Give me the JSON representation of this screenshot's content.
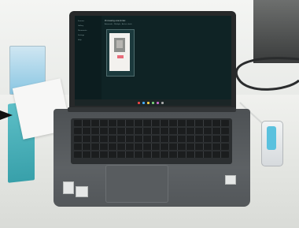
{
  "scene": {
    "description_items": [
      "laptop",
      "usb-device",
      "cables",
      "desk"
    ]
  },
  "screen": {
    "heading": "Processing scan/index",
    "subheading": "Automatic · Multiple · Active check",
    "sidebar_items": [
      "Scanner",
      "Gallery",
      "Documents",
      "Settings",
      "Help"
    ]
  },
  "colors": {
    "screen_bg": "#0f2325",
    "accent": "#e96c7a",
    "usb_light": "#5ac1de",
    "tray": "#38a0aa"
  },
  "icons": {
    "arrow": "arrow-right-icon"
  }
}
